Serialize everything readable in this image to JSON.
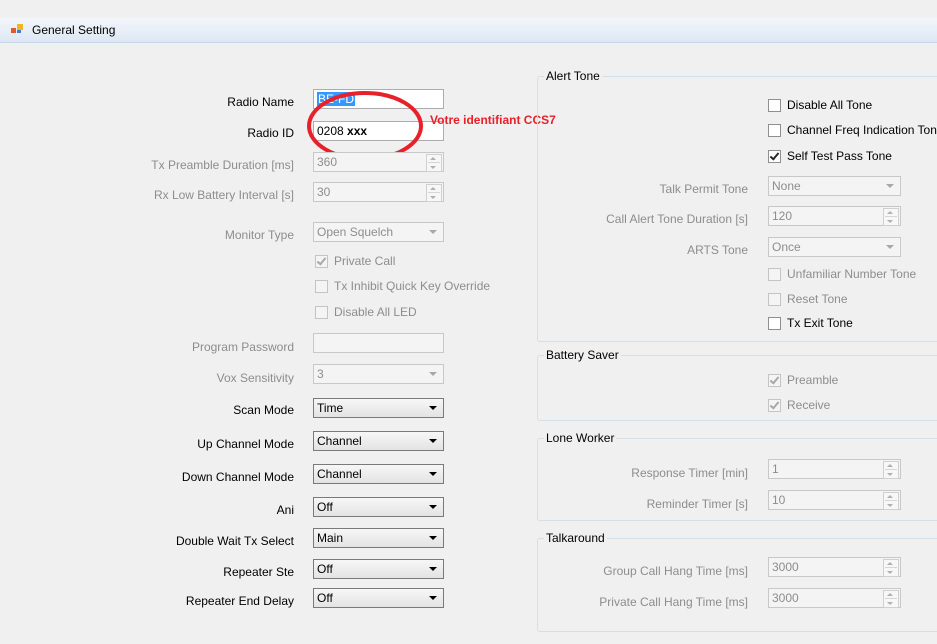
{
  "window": {
    "title": "General Setting"
  },
  "left": {
    "radio_name": {
      "label": "Radio Name",
      "value": "BE-FD"
    },
    "radio_id": {
      "label": "Radio ID",
      "value_prefix": "0208",
      "value_suffix": "xxx"
    },
    "annotation": "Votre identifiant CCS7",
    "tx_preamble": {
      "label": "Tx Preamble Duration [ms]",
      "value": "360"
    },
    "rx_low_battery": {
      "label": "Rx Low Battery Interval [s]",
      "value": "30"
    },
    "monitor_type": {
      "label": "Monitor Type",
      "value": "Open Squelch"
    },
    "private_call": {
      "label": "Private Call",
      "checked": true
    },
    "tx_inhibit": {
      "label": "Tx Inhibit Quick Key Override",
      "checked": false
    },
    "disable_all_led": {
      "label": "Disable All LED",
      "checked": false
    },
    "program_password": {
      "label": "Program Password",
      "value": ""
    },
    "vox_sensitivity": {
      "label": "Vox Sensitivity",
      "value": "3"
    },
    "scan_mode": {
      "label": "Scan Mode",
      "value": "Time"
    },
    "up_channel_mode": {
      "label": "Up Channel Mode",
      "value": "Channel"
    },
    "down_channel_mode": {
      "label": "Down Channel Mode",
      "value": "Channel"
    },
    "ani": {
      "label": "Ani",
      "value": "Off"
    },
    "double_wait": {
      "label": "Double Wait Tx Select",
      "value": "Main"
    },
    "repeater_ste": {
      "label": "Repeater Ste",
      "value": "Off"
    },
    "repeater_end_delay": {
      "label": "Repeater End Delay",
      "value": "Off"
    }
  },
  "alert_tone": {
    "legend": "Alert Tone",
    "disable_all_tone": {
      "label": "Disable All Tone",
      "checked": false
    },
    "channel_freq": {
      "label": "Channel Freq Indication Tone",
      "checked": false
    },
    "self_test": {
      "label": "Self Test Pass Tone",
      "checked": true
    },
    "talk_permit": {
      "label": "Talk Permit Tone",
      "value": "None"
    },
    "call_alert_duration": {
      "label": "Call Alert Tone Duration [s]",
      "value": "120"
    },
    "arts_tone": {
      "label": "ARTS Tone",
      "value": "Once"
    },
    "unfamiliar": {
      "label": "Unfamiliar Number Tone",
      "checked": false
    },
    "reset_tone": {
      "label": "Reset Tone",
      "checked": false
    },
    "tx_exit": {
      "label": "Tx Exit Tone",
      "checked": false
    }
  },
  "battery_saver": {
    "legend": "Battery Saver",
    "preamble": {
      "label": "Preamble",
      "checked": true
    },
    "receive": {
      "label": "Receive",
      "checked": true
    }
  },
  "lone_worker": {
    "legend": "Lone Worker",
    "response_timer": {
      "label": "Response Timer [min]",
      "value": "1"
    },
    "reminder_timer": {
      "label": "Reminder Timer [s]",
      "value": "10"
    }
  },
  "talkaround": {
    "legend": "Talkaround",
    "group_call": {
      "label": "Group Call Hang Time [ms]",
      "value": "3000"
    },
    "private_call": {
      "label": "Private Call Hang Time [ms]",
      "value": "3000"
    }
  },
  "colors": {
    "annotation_red": "#e8202a",
    "titlebar": "#dde7f3",
    "selection": "#3399ff"
  },
  "icons": {
    "app": "settings-app-icon",
    "check": "checkmark-icon",
    "dropdown": "chevron-down-icon",
    "spin": "spinner-arrows-icon"
  }
}
